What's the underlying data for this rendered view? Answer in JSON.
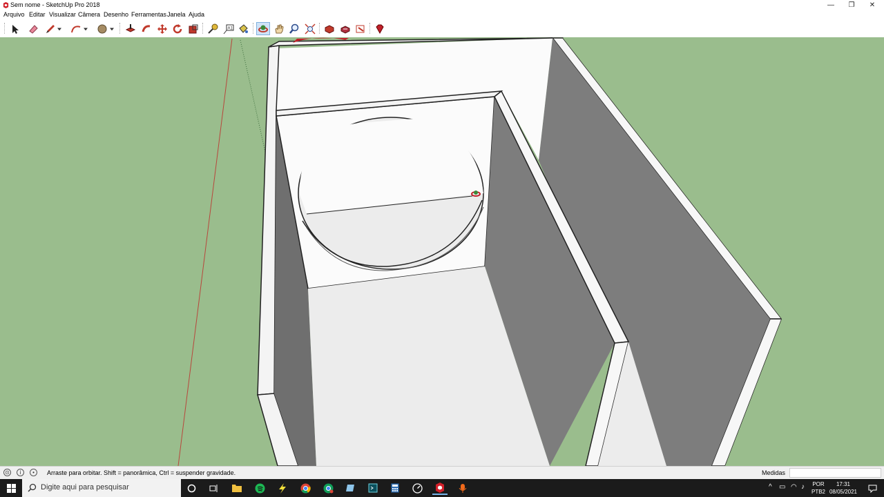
{
  "window": {
    "title": "Sem nome - SketchUp Pro 2018"
  },
  "menu": [
    "Arquivo",
    "Editar",
    "Visualizar",
    "Câmera",
    "Desenho",
    "Ferramentas",
    "Janela",
    "Ajuda"
  ],
  "toolbar": {
    "tools": [
      "select",
      "eraser",
      "line",
      "arc",
      "circle",
      "push-pull",
      "follow-me",
      "move",
      "rotate",
      "scale",
      "tape-measure",
      "text",
      "paint-bucket",
      "orbit",
      "pan",
      "zoom",
      "zoom-extents",
      "warehouse",
      "extension-warehouse",
      "layout",
      "ruby"
    ],
    "active_tool": "orbit"
  },
  "statusbar": {
    "message": "Arraste para orbitar. Shift = panorâmica, Ctrl = suspender gravidade.",
    "measurements_label": "Medidas",
    "measurements_value": ""
  },
  "taskbar": {
    "search_placeholder": "Digite aqui para pesquisar",
    "language_top": "POR",
    "language_bottom": "PTB2",
    "time": "17:31",
    "date": "08/05/2021"
  },
  "colors": {
    "sky_ground": "#9abd8d",
    "taskbar": "#1b1b1b",
    "face_light": "#f4f4f4",
    "face_dark": "#7c7c7c"
  }
}
